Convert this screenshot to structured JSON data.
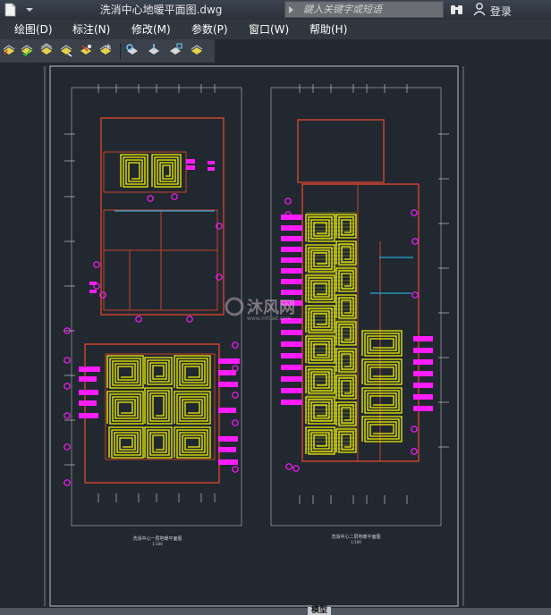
{
  "title_bar": {
    "file_title": "洗消中心地暖平面图.dwg",
    "search_placeholder": "鍵入关键字或短语",
    "login_label": "登录"
  },
  "menu": [
    {
      "label": "绘图(D)"
    },
    {
      "label": "标注(N)"
    },
    {
      "label": "修改(M)"
    },
    {
      "label": "参数(P)"
    },
    {
      "label": "窗口(W)"
    },
    {
      "label": "帮助(H)"
    }
  ],
  "toolbar": {
    "icons": [
      "layer-tool-icon",
      "layer-tool-icon",
      "layer-tool-icon",
      "layer-tool-icon",
      "layer-tool-icon",
      "layer-tool-icon",
      "layer-tool-icon",
      "layer-tool-icon",
      "layer-tool-icon",
      "layer-tool-icon"
    ]
  },
  "drawing": {
    "left_plan_caption": "洗消中心一层地暖平面图",
    "left_plan_scale": "1:100",
    "right_plan_caption": "洗消中心二层地暖平面图",
    "right_plan_scale": "1:100",
    "watermark": "沐风网",
    "watermark_url": "www.mfcad.com"
  },
  "status_bar": {
    "model_label": "模型"
  },
  "colors": {
    "canvas": "#212830",
    "wall": "#c8422e",
    "heating_pipe": "#f2f200",
    "annotation": "#ff1cff",
    "dimension": "#d8d8d8",
    "pipe_blue": "#24c7ff"
  }
}
